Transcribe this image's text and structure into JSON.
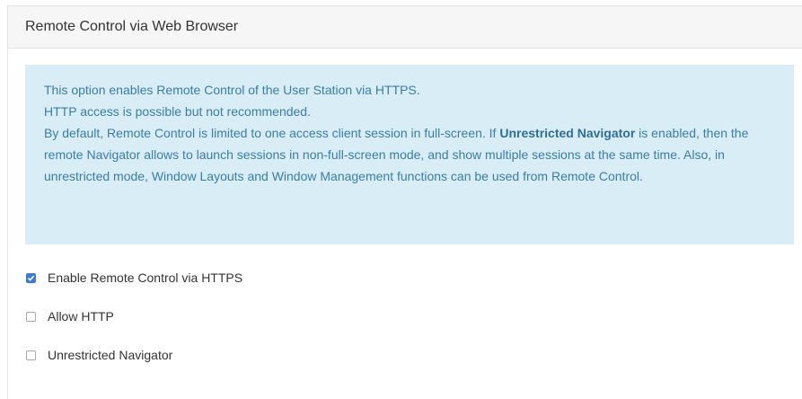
{
  "panel": {
    "title": "Remote Control via Web Browser"
  },
  "info": {
    "line1": "This option enables Remote Control of the User Station via HTTPS.",
    "line2": "HTTP access is possible but not recommended.",
    "line3_before": "By default, Remote Control is limited to one access client session in full-screen. If ",
    "line3_bold": "Unrestricted Navigator",
    "line3_after": " is enabled, then the remote Navigator allows to launch sessions in non-full-screen mode, and show multiple sessions at the same time. Also, in unrestricted mode, Window Layouts and Window Management functions can be used from Remote Control."
  },
  "options": [
    {
      "label": "Enable Remote Control via HTTPS",
      "checked": true
    },
    {
      "label": "Allow HTTP",
      "checked": false
    },
    {
      "label": "Unrestricted Navigator",
      "checked": false
    }
  ],
  "colors": {
    "info_bg": "#d8edf6",
    "info_text": "#3a7ea5",
    "checkbox_checked": "#3b7bd4"
  }
}
